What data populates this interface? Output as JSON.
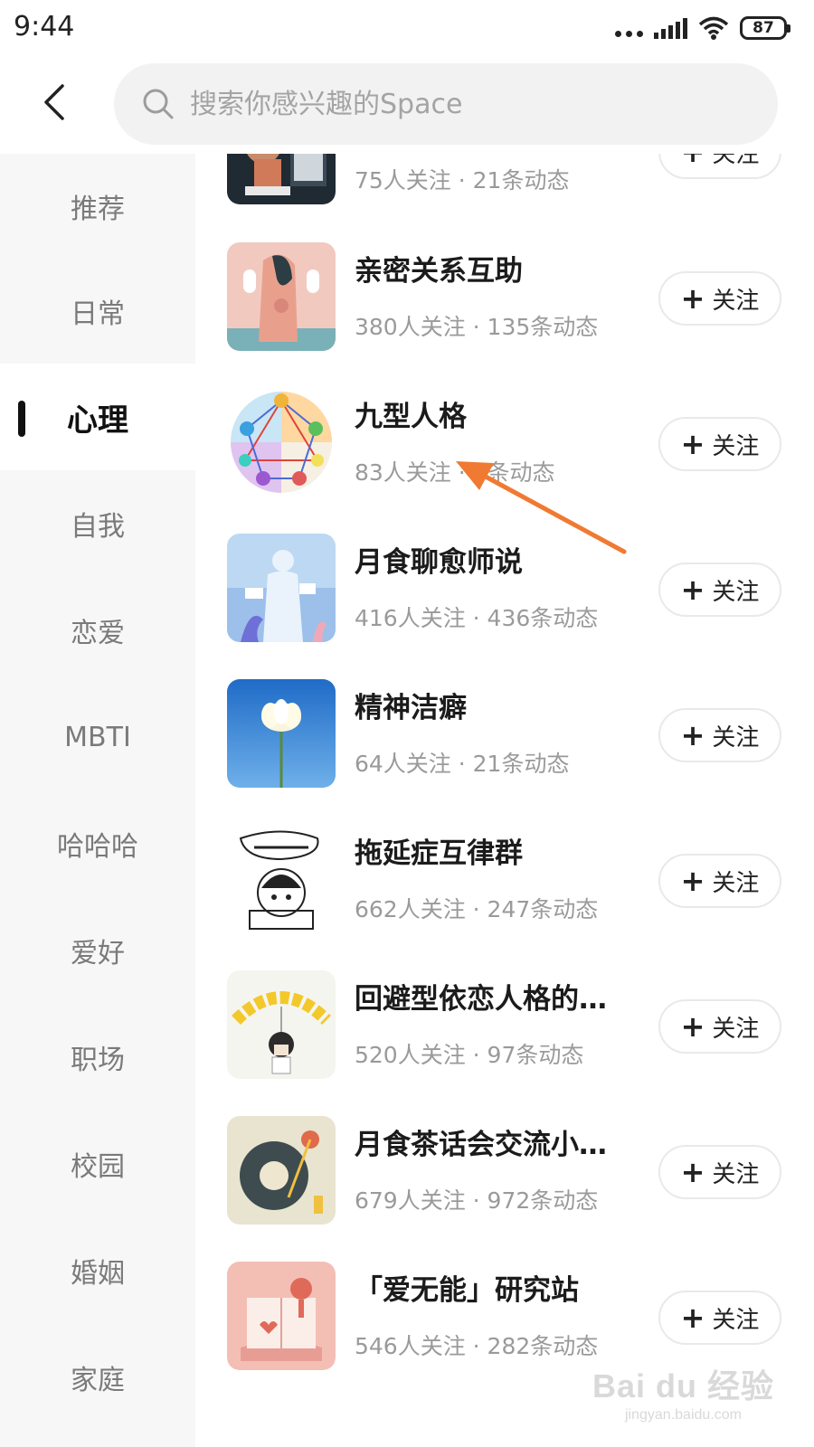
{
  "status_bar": {
    "time": "9:44",
    "battery": "87"
  },
  "search": {
    "placeholder": "搜索你感兴趣的Space"
  },
  "sidebar": {
    "items": [
      {
        "label": "推荐"
      },
      {
        "label": "日常"
      },
      {
        "label": "心理"
      },
      {
        "label": "自我"
      },
      {
        "label": "恋爱"
      },
      {
        "label": "MBTI"
      },
      {
        "label": "哈哈哈"
      },
      {
        "label": "爱好"
      },
      {
        "label": "职场"
      },
      {
        "label": "校园"
      },
      {
        "label": "婚姻"
      },
      {
        "label": "家庭"
      }
    ],
    "active": "心理"
  },
  "follow_label": "关注",
  "spaces": [
    {
      "title": "",
      "meta": "75人关注 · 21条动态",
      "icon": "person-photo"
    },
    {
      "title": "亲密关系互助",
      "meta": "380人关注 · 135条动态",
      "icon": "masks-illustration"
    },
    {
      "title": "九型人格",
      "meta": "83人关注 · 1条动态",
      "icon": "enneagram-diagram"
    },
    {
      "title": "月食聊愈师说",
      "meta": "416人关注 · 436条动态",
      "icon": "silhouette-illustration"
    },
    {
      "title": "精神洁癖",
      "meta": "64人关注 · 21条动态",
      "icon": "lotus-photo"
    },
    {
      "title": "拖延症互律群",
      "meta": "662人关注 · 247条动态",
      "icon": "cartoon-sketch"
    },
    {
      "title": "回避型依恋人格的…",
      "meta": "520人关注 · 97条动态",
      "icon": "flower-girl-illustration"
    },
    {
      "title": "月食茶话会交流小…",
      "meta": "679人关注 · 972条动态",
      "icon": "record-player-illustration"
    },
    {
      "title": "「爱无能」研究站",
      "meta": "546人关注 · 282条动态",
      "icon": "open-book-illustration"
    }
  ],
  "watermark": {
    "logo": "Bai du 经验",
    "url": "jingyan.baidu.com"
  },
  "colors": {
    "annotation_arrow": "#f07a32",
    "sidebar_bg": "#f7f7f7",
    "search_bg": "#f2f2f2"
  }
}
